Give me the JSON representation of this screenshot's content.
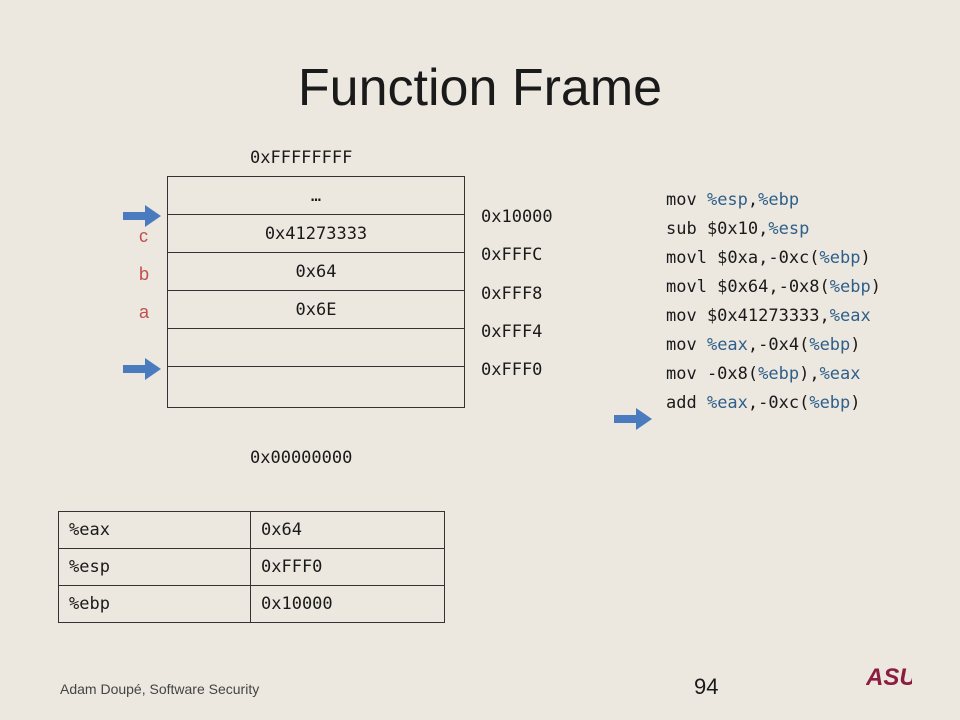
{
  "title": "Function Frame",
  "addresses": {
    "top": "0xFFFFFFFF",
    "bottom": "0x00000000"
  },
  "stack": {
    "cells": [
      "…",
      "0x41273333",
      "0x64",
      "0x6E",
      "",
      ""
    ],
    "side_addresses": [
      "0x10000",
      "0xFFFC",
      "0xFFF8",
      "0xFFF4",
      "0xFFF0"
    ],
    "var_labels": [
      "c",
      "b",
      "a"
    ]
  },
  "assembly": [
    [
      {
        "t": "mov "
      },
      {
        "t": "%esp",
        "r": true
      },
      {
        "t": ","
      },
      {
        "t": "%ebp",
        "r": true
      }
    ],
    [
      {
        "t": "sub $0x10,"
      },
      {
        "t": "%esp",
        "r": true
      }
    ],
    [
      {
        "t": "movl $0xa,-0xc("
      },
      {
        "t": "%ebp",
        "r": true
      },
      {
        "t": ")"
      }
    ],
    [
      {
        "t": "movl $0x64,-0x8("
      },
      {
        "t": "%ebp",
        "r": true
      },
      {
        "t": ")"
      }
    ],
    [
      {
        "t": "mov $0x41273333,"
      },
      {
        "t": "%eax",
        "r": true
      }
    ],
    [
      {
        "t": "mov "
      },
      {
        "t": "%eax",
        "r": true
      },
      {
        "t": ",-0x4("
      },
      {
        "t": "%ebp",
        "r": true
      },
      {
        "t": ")"
      }
    ],
    [
      {
        "t": "mov -0x8("
      },
      {
        "t": "%ebp",
        "r": true
      },
      {
        "t": "),"
      },
      {
        "t": "%eax",
        "r": true
      }
    ],
    [
      {
        "t": "add "
      },
      {
        "t": "%eax",
        "r": true
      },
      {
        "t": ",-0xc("
      },
      {
        "t": "%ebp",
        "r": true
      },
      {
        "t": ")"
      }
    ]
  ],
  "registers": [
    {
      "name": "%eax",
      "value": "0x64"
    },
    {
      "name": "%esp",
      "value": "0xFFF0"
    },
    {
      "name": "%ebp",
      "value": "0x10000"
    }
  ],
  "footer": "Adam Doupé, Software Security",
  "page_number": "94",
  "logo_text": "ASU",
  "colors": {
    "arrow": "#4a7bbf",
    "register": "#2e5f8a",
    "var_label": "#c0504d",
    "logo": "#8c1d40"
  }
}
